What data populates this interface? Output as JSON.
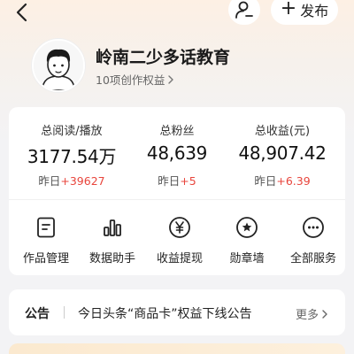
{
  "header": {
    "back_icon": "chevron-left-icon",
    "user_icon": "user-settings-icon",
    "publish_label": "发布"
  },
  "profile": {
    "name": "岭南二少多话教育",
    "rights_text": "10项创作权益"
  },
  "stats": [
    {
      "label": "总阅读/播放",
      "value": "3177.54万",
      "delta_prefix": "昨日",
      "delta": "+39627"
    },
    {
      "label": "总粉丝",
      "value": "48,639",
      "delta_prefix": "昨日",
      "delta": "+5"
    },
    {
      "label": "总收益(元)",
      "value": "48,907.42",
      "delta_prefix": "昨日",
      "delta": "+6.39"
    }
  ],
  "tools": [
    {
      "label": "作品管理",
      "icon": "document-icon"
    },
    {
      "label": "数据助手",
      "icon": "bar-chart-icon"
    },
    {
      "label": "收益提现",
      "icon": "yuan-icon"
    },
    {
      "label": "勋章墙",
      "icon": "medal-icon"
    },
    {
      "label": "全部服务",
      "icon": "more-icon"
    }
  ],
  "notice": {
    "title": "公告",
    "text": "今日头条“商品卡”权益下线公告",
    "more": "更多"
  },
  "colors": {
    "accent_red": "#e8453c",
    "card_bg": "#ffffff",
    "page_bg": "#f3f3f5"
  }
}
